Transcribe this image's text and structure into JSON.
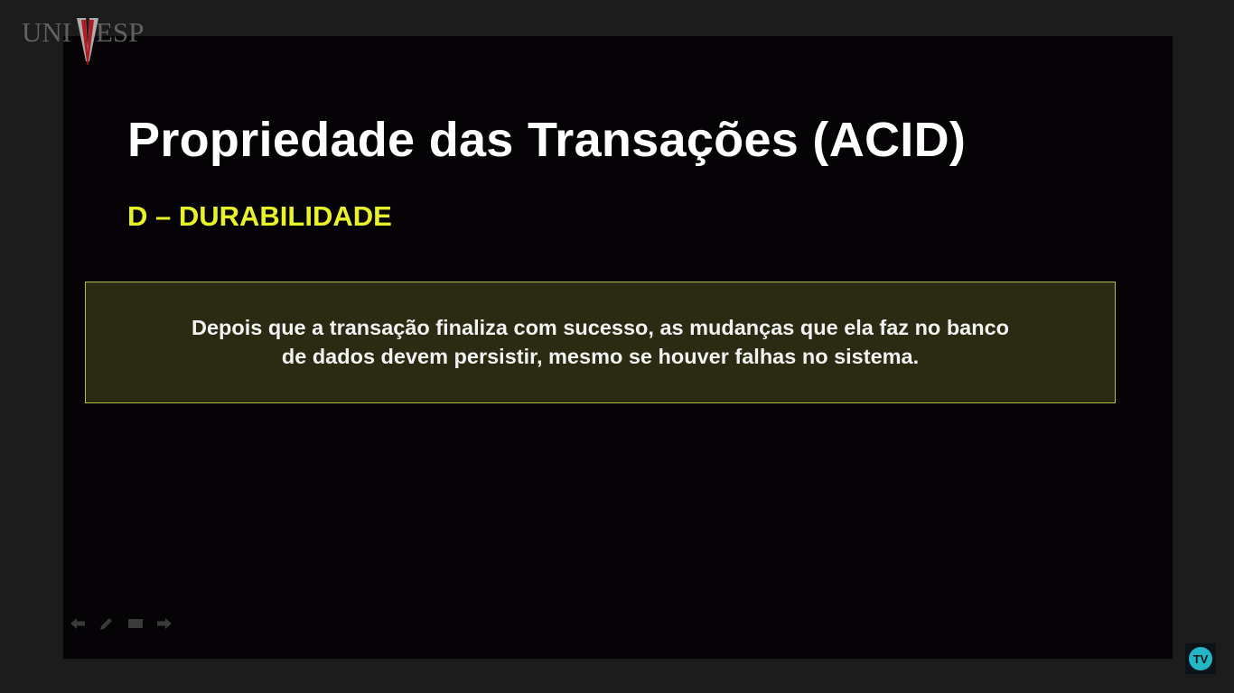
{
  "logo": {
    "text_left": "UNI",
    "text_right": "ESP",
    "center_letter": "V"
  },
  "slide": {
    "title": "Propriedade das Transações (ACID)",
    "subtitle": "D – DURABILIDADE",
    "definition_line1": "Depois que a transação finaliza com sucesso, as mudanças que ela faz no banco",
    "definition_line2": "de dados devem persistir, mesmo se houver falhas no sistema."
  },
  "controls": {
    "icons": [
      "arrow-left-icon",
      "pen-icon",
      "slides-icon",
      "arrow-right-icon"
    ]
  },
  "tv_logo": {
    "text": "TV"
  },
  "colors": {
    "title": "#ffffff",
    "subtitle": "#e7f229",
    "box_fill": "#2b2a12",
    "box_border": "#b7b84a",
    "background": "#050306",
    "tv_accent": "#23b6c4"
  }
}
